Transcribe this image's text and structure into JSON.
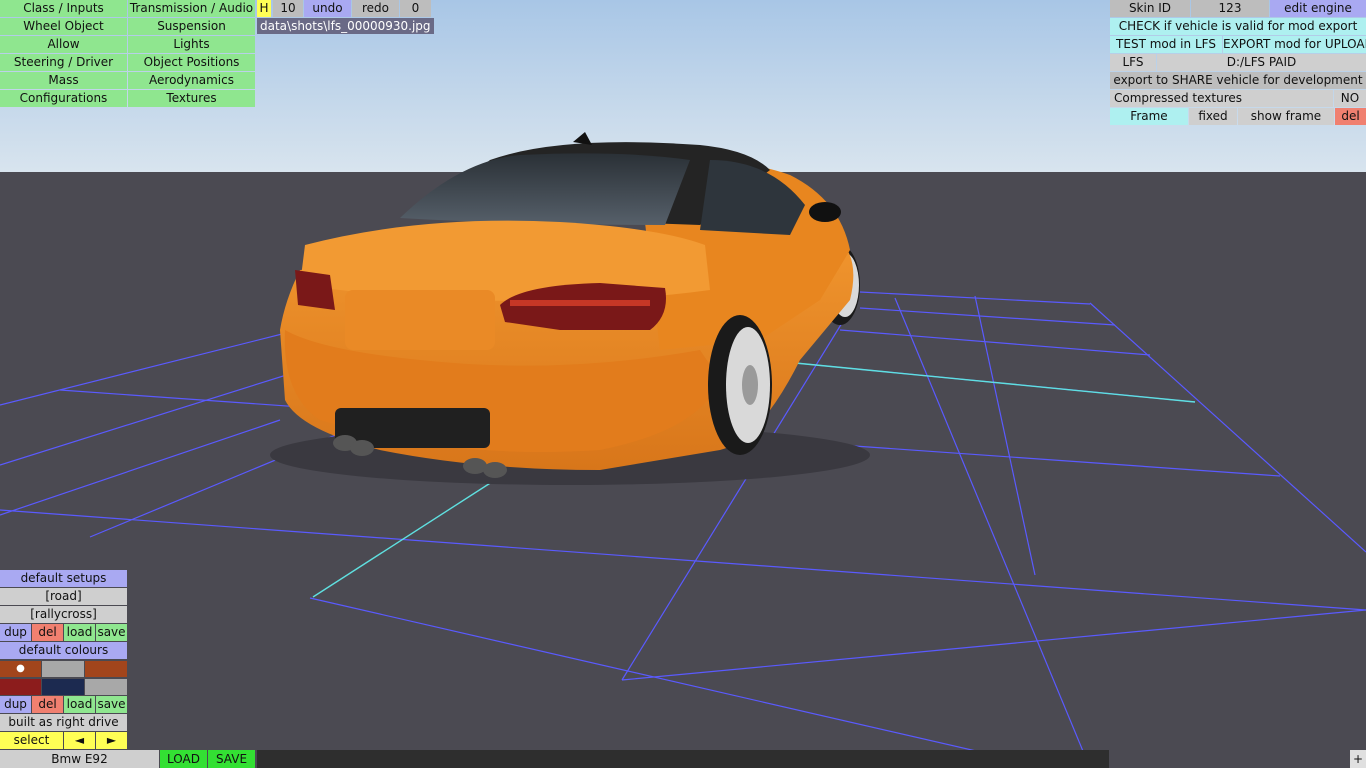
{
  "menu_left": {
    "class_inputs": "Class / Inputs",
    "transmission_audio": "Transmission / Audio",
    "wheel_object": "Wheel Object",
    "suspension": "Suspension",
    "allow": "Allow",
    "lights": "Lights",
    "steering_driver": "Steering / Driver",
    "object_positions": "Object Positions",
    "mass": "Mass",
    "aerodynamics": "Aerodynamics",
    "configurations": "Configurations",
    "textures": "Textures"
  },
  "top_toolbar": {
    "h_label": "H",
    "count": "10",
    "undo": "undo",
    "redo": "redo",
    "zero": "0",
    "file_path": "data\\shots\\lfs_00000930.jpg"
  },
  "right_panel": {
    "skin_id_label": "Skin ID",
    "skin_id_value": "123",
    "edit_engine": "edit engine",
    "check_valid": "CHECK if vehicle is valid for mod export",
    "test_mod": "TEST mod in LFS",
    "export_mod": "EXPORT mod for UPLOAD",
    "lfs_label": "LFS",
    "lfs_path": "D:/LFS PAID",
    "export_share": "export to SHARE vehicle for development",
    "compressed_textures": "Compressed textures",
    "compressed_value": "NO",
    "frame": "Frame",
    "fixed": "fixed",
    "show_frame": "show frame",
    "del": "del"
  },
  "bottom_left": {
    "default_setups": "default setups",
    "road": "[road]",
    "rallycross": "[rallycross]",
    "dup": "dup",
    "del": "del",
    "load": "load",
    "save": "save",
    "default_colours": "default colours",
    "selected_marker": "●",
    "built_as": "built as right drive",
    "select": "select",
    "arrow_left": "◄",
    "arrow_right": "►"
  },
  "colours": {
    "orange_brown": "#a2451c",
    "grey": "#a8a8a8",
    "dark_red": "#8c1c1c",
    "navy": "#1c2a50"
  },
  "bottom_bar": {
    "vehicle_name": "Bmw E92",
    "load": "LOAD",
    "save": "SAVE",
    "plus": "+"
  }
}
